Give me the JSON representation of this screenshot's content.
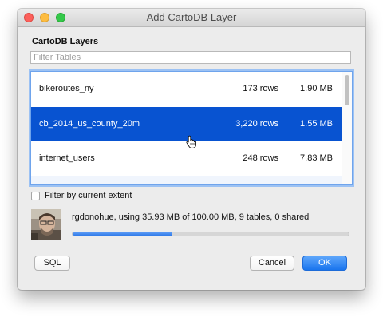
{
  "window": {
    "title": "Add CartoDB Layer"
  },
  "layers": {
    "section_label": "CartoDB Layers",
    "filter_placeholder": "Filter Tables",
    "filter_value": "",
    "tables": [
      {
        "name": "bikeroutes_ny",
        "rows": "173 rows",
        "size": "1.90 MB",
        "selected": false
      },
      {
        "name": "cb_2014_us_county_20m",
        "rows": "3,220 rows",
        "size": "1.55 MB",
        "selected": true
      },
      {
        "name": "internet_users",
        "rows": "248 rows",
        "size": "7.83 MB",
        "selected": false
      }
    ]
  },
  "filter_extent": {
    "label": "Filter by current extent",
    "checked": false
  },
  "account": {
    "usage_text": "rgdonohue, using 35.93 MB of 100.00 MB, 9 tables, 0 shared",
    "usage_fraction": 0.3593
  },
  "buttons": {
    "sql": "SQL",
    "cancel": "Cancel",
    "ok": "OK"
  },
  "colors": {
    "selection": "#0853d1",
    "accent": "#1a75ee"
  },
  "icons": {
    "close": "close-icon",
    "minimize": "minimize-icon",
    "maximize": "maximize-icon",
    "cursor": "hand-pointer-icon",
    "avatar": "user-avatar"
  }
}
